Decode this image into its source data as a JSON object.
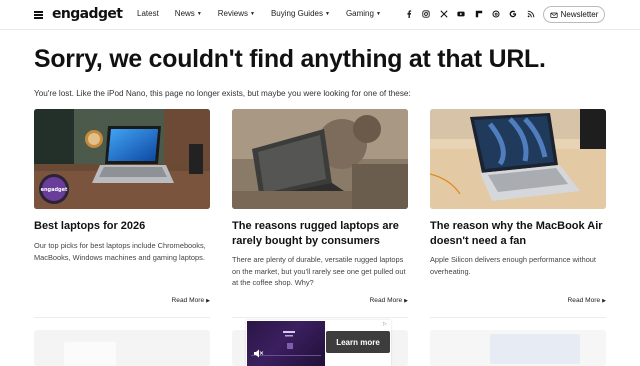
{
  "header": {
    "logo": "engadget",
    "nav": [
      {
        "label": "Latest",
        "has_menu": false
      },
      {
        "label": "News",
        "has_menu": true
      },
      {
        "label": "Reviews",
        "has_menu": true
      },
      {
        "label": "Buying Guides",
        "has_menu": true
      },
      {
        "label": "Gaming",
        "has_menu": true
      }
    ],
    "socials": [
      "facebook-icon",
      "instagram-icon",
      "x-icon",
      "youtube-icon",
      "flipboard-icon",
      "threads-icon",
      "google-icon",
      "rss-icon"
    ],
    "newsletter_label": "Newsletter"
  },
  "page": {
    "title": "Sorry, we couldn't find anything at that URL.",
    "intro": "You're lost. Like the iPod Nano, this page no longer exists, but maybe you were looking for one of these:"
  },
  "cards": [
    {
      "title": "Best laptops for 2026",
      "description": "Our top picks for best laptops include Chromebooks, MacBooks, Windows machines and gaming laptops.",
      "read_more": "Read More",
      "badge": "engadget"
    },
    {
      "title": "The reasons rugged laptops are rarely bought by consumers",
      "description": "There are plenty of durable, versatile rugged laptops on the market, but you'll rarely see one get pulled out at the coffee shop. Why?",
      "read_more": "Read More"
    },
    {
      "title": "The reason why the MacBook Air doesn't need a fan",
      "description": "Apple Silicon delivers enough performance without overheating.",
      "read_more": "Read More"
    }
  ],
  "ad": {
    "button_label": "Learn more"
  },
  "colors": {
    "text": "#111111",
    "muted": "#444444",
    "divider": "#e9e9e9",
    "ad_button": "#3d3d3d"
  }
}
